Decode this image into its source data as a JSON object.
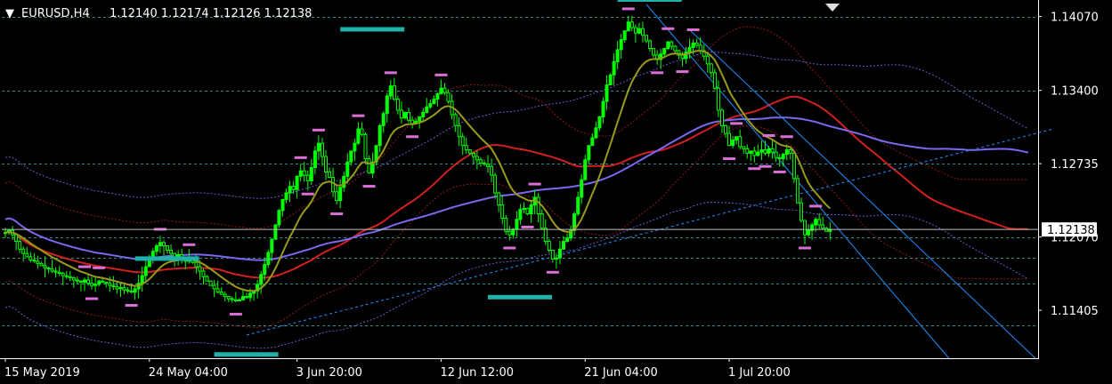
{
  "header": {
    "menu_glyph": "▼",
    "symbol": "EURUSD,H4",
    "ohlc": "1.12140 1.12174 1.12126 1.12138"
  },
  "colors": {
    "background": "#000000",
    "candles": "#00ff00",
    "grid": "#2e8b8b",
    "ema_fast": "#9a9a1a",
    "ma_slow_red": "#d22020",
    "ma_slow_blue": "#7b68ee",
    "envelope_red": "#8b1a1a",
    "envelope_blue": "#6a5acd",
    "trend_channel": "#1e90ff",
    "fractal_marks": "#da70d6",
    "sr_bars": "#20b2aa",
    "price_box_bg": "#ffffff"
  },
  "chart_data": {
    "type": "candlestick",
    "symbol": "EURUSD",
    "timeframe": "H4",
    "ylim": [
      1.1097,
      1.1422
    ],
    "y_ticks": [
      {
        "value": 1.1407,
        "label": "1.14070"
      },
      {
        "value": 1.134,
        "label": "1.13400"
      },
      {
        "value": 1.12735,
        "label": "1.12735"
      },
      {
        "value": 1.1207,
        "label": "1.12070"
      },
      {
        "value": 1.11405,
        "label": "1.11405"
      }
    ],
    "current_price": {
      "value": 1.12138,
      "label": "1.12138"
    },
    "x_ticks": [
      {
        "bar": 0,
        "label": "15 May 2019"
      },
      {
        "bar": 40,
        "label": "24 May 04:00"
      },
      {
        "bar": 81,
        "label": "3 Jun 20:00"
      },
      {
        "bar": 121,
        "label": "12 Jun 12:00"
      },
      {
        "bar": 161,
        "label": "21 Jun 04:00"
      },
      {
        "bar": 201,
        "label": "1 Jul 20:00"
      }
    ],
    "close_series": [
      1.1211,
      1.1213,
      1.1209,
      1.1203,
      1.1196,
      1.1192,
      1.1189,
      1.1186,
      1.1185,
      1.1183,
      1.1181,
      1.1179,
      1.1178,
      1.1176,
      1.1175,
      1.1174,
      1.1172,
      1.1171,
      1.117,
      1.1168,
      1.1167,
      1.1166,
      1.1168,
      1.1165,
      1.1163,
      1.1164,
      1.1167,
      1.1166,
      1.1165,
      1.1163,
      1.1162,
      1.116,
      1.1161,
      1.1159,
      1.1158,
      1.1157,
      1.116,
      1.1165,
      1.1172,
      1.118,
      1.1186,
      1.1194,
      1.1199,
      1.1202,
      1.1199,
      1.1195,
      1.1192,
      1.1189,
      1.1191,
      1.1187,
      1.1185,
      1.1188,
      1.1184,
      1.118,
      1.1176,
      1.1171,
      1.1167,
      1.1163,
      1.116,
      1.1157,
      1.1155,
      1.1153,
      1.1151,
      1.115,
      1.1149,
      1.115,
      1.1153,
      1.1152,
      1.1156,
      1.1158,
      1.1164,
      1.1173,
      1.1182,
      1.1193,
      1.1205,
      1.1218,
      1.1231,
      1.1241,
      1.1247,
      1.1253,
      1.125,
      1.1262,
      1.1267,
      1.1263,
      1.1258,
      1.127,
      1.1285,
      1.1292,
      1.128,
      1.1266,
      1.1261,
      1.1248,
      1.124,
      1.1252,
      1.1262,
      1.1275,
      1.1285,
      1.1292,
      1.1305,
      1.13,
      1.1278,
      1.1265,
      1.1275,
      1.129,
      1.1308,
      1.1319,
      1.1335,
      1.1344,
      1.1332,
      1.1322,
      1.1315,
      1.132,
      1.1313,
      1.131,
      1.1312,
      1.1316,
      1.132,
      1.1325,
      1.1328,
      1.1332,
      1.1337,
      1.1342,
      1.1338,
      1.133,
      1.1318,
      1.1308,
      1.1298,
      1.129,
      1.1286,
      1.1283,
      1.128,
      1.1277,
      1.1274,
      1.1273,
      1.1271,
      1.1263,
      1.1247,
      1.1236,
      1.1224,
      1.1212,
      1.1209,
      1.1214,
      1.1223,
      1.1232,
      1.1233,
      1.1228,
      1.1236,
      1.1243,
      1.1228,
      1.1215,
      1.1203,
      1.1195,
      1.1187,
      1.1188,
      1.1196,
      1.1203,
      1.1206,
      1.1213,
      1.1228,
      1.1243,
      1.1259,
      1.1277,
      1.129,
      1.1297,
      1.1306,
      1.1316,
      1.133,
      1.1345,
      1.1354,
      1.1366,
      1.1377,
      1.1386,
      1.1394,
      1.1402,
      1.1397,
      1.1392,
      1.1396,
      1.139,
      1.1385,
      1.1378,
      1.1372,
      1.1368,
      1.1373,
      1.1378,
      1.1384,
      1.138,
      1.1376,
      1.1372,
      1.1369,
      1.1375,
      1.1379,
      1.1383,
      1.1381,
      1.1376,
      1.1371,
      1.1364,
      1.1356,
      1.1342,
      1.1322,
      1.1308,
      1.1301,
      1.129,
      1.1295,
      1.1298,
      1.1289,
      1.1287,
      1.1283,
      1.1285,
      1.1281,
      1.1284,
      1.1286,
      1.1283,
      1.1287,
      1.1284,
      1.1279,
      1.1278,
      1.1282,
      1.1286,
      1.1283,
      1.126,
      1.1238,
      1.1222,
      1.1209,
      1.1213,
      1.1218,
      1.1223,
      1.1218,
      1.1215,
      1.1212,
      1.1214
    ],
    "bars_visible": 230,
    "indicators": [
      {
        "name": "fast moving average",
        "color": "#9a9a1a"
      },
      {
        "name": "slow moving average",
        "color": "#d22020"
      },
      {
        "name": "long moving average",
        "color": "#7b68ee"
      },
      {
        "name": "envelope bands",
        "color": "#8b1a1a"
      },
      {
        "name": "trend channel",
        "color": "#1e90ff"
      }
    ],
    "support_resistance_levels": [
      1.1187,
      1.1152,
      1.1133,
      1.1105,
      1.1395,
      1.1418
    ],
    "horizontal_levels": [
      1.1407,
      1.134,
      1.12735,
      1.1207,
      1.1188,
      1.1165,
      1.1127
    ],
    "grid": true
  }
}
